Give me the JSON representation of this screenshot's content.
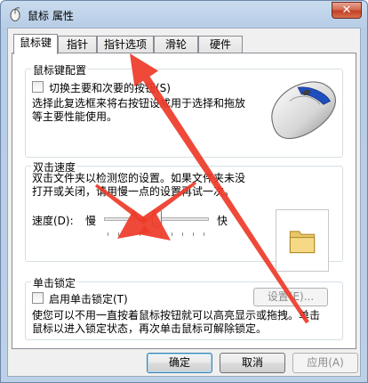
{
  "window": {
    "title": "鼠标 属性",
    "close_symbol": "✕"
  },
  "tabs": [
    {
      "label": "鼠标键",
      "active": true
    },
    {
      "label": "指针",
      "active": false
    },
    {
      "label": "指针选项",
      "active": false
    },
    {
      "label": "滑轮",
      "active": false
    },
    {
      "label": "硬件",
      "active": false
    }
  ],
  "button_config": {
    "legend": "鼠标键配置",
    "swap_label": "切换主要和次要的按钮(S)",
    "swap_checked": false,
    "description_line1": "选择此复选框来将右按钮设成用于选择和拖放",
    "description_line2": "等主要性能使用。"
  },
  "double_click": {
    "legend": "双击速度",
    "description_line1": "双击文件夹以检测您的设置。如果文件夹未没",
    "description_line2": "打开或关闭，请用慢一点的设置再试一次。",
    "speed_label": "速度(D):",
    "slow_label": "慢",
    "fast_label": "快",
    "speed_fraction": 0.5
  },
  "click_lock": {
    "legend": "单击锁定",
    "enable_label": "启用单击锁定(T)",
    "enable_checked": false,
    "settings_button": "设置(E)...",
    "description_line1": "使您可以不用一直按着鼠标按钮就可以高亮显示或拖拽。单击",
    "description_line2": "鼠标以进入锁定状态，再次单击鼠标可解除锁定。"
  },
  "footer": {
    "ok": "确定",
    "cancel": "取消",
    "apply": "应用(A)"
  },
  "icons": {
    "app": "mouse-app-icon",
    "mouse": "mouse-illustration-icon",
    "folder": "folder-icon"
  },
  "colors": {
    "annotation_arrow": "#ee3b2a",
    "accent_blue": "#1f4fbf"
  }
}
